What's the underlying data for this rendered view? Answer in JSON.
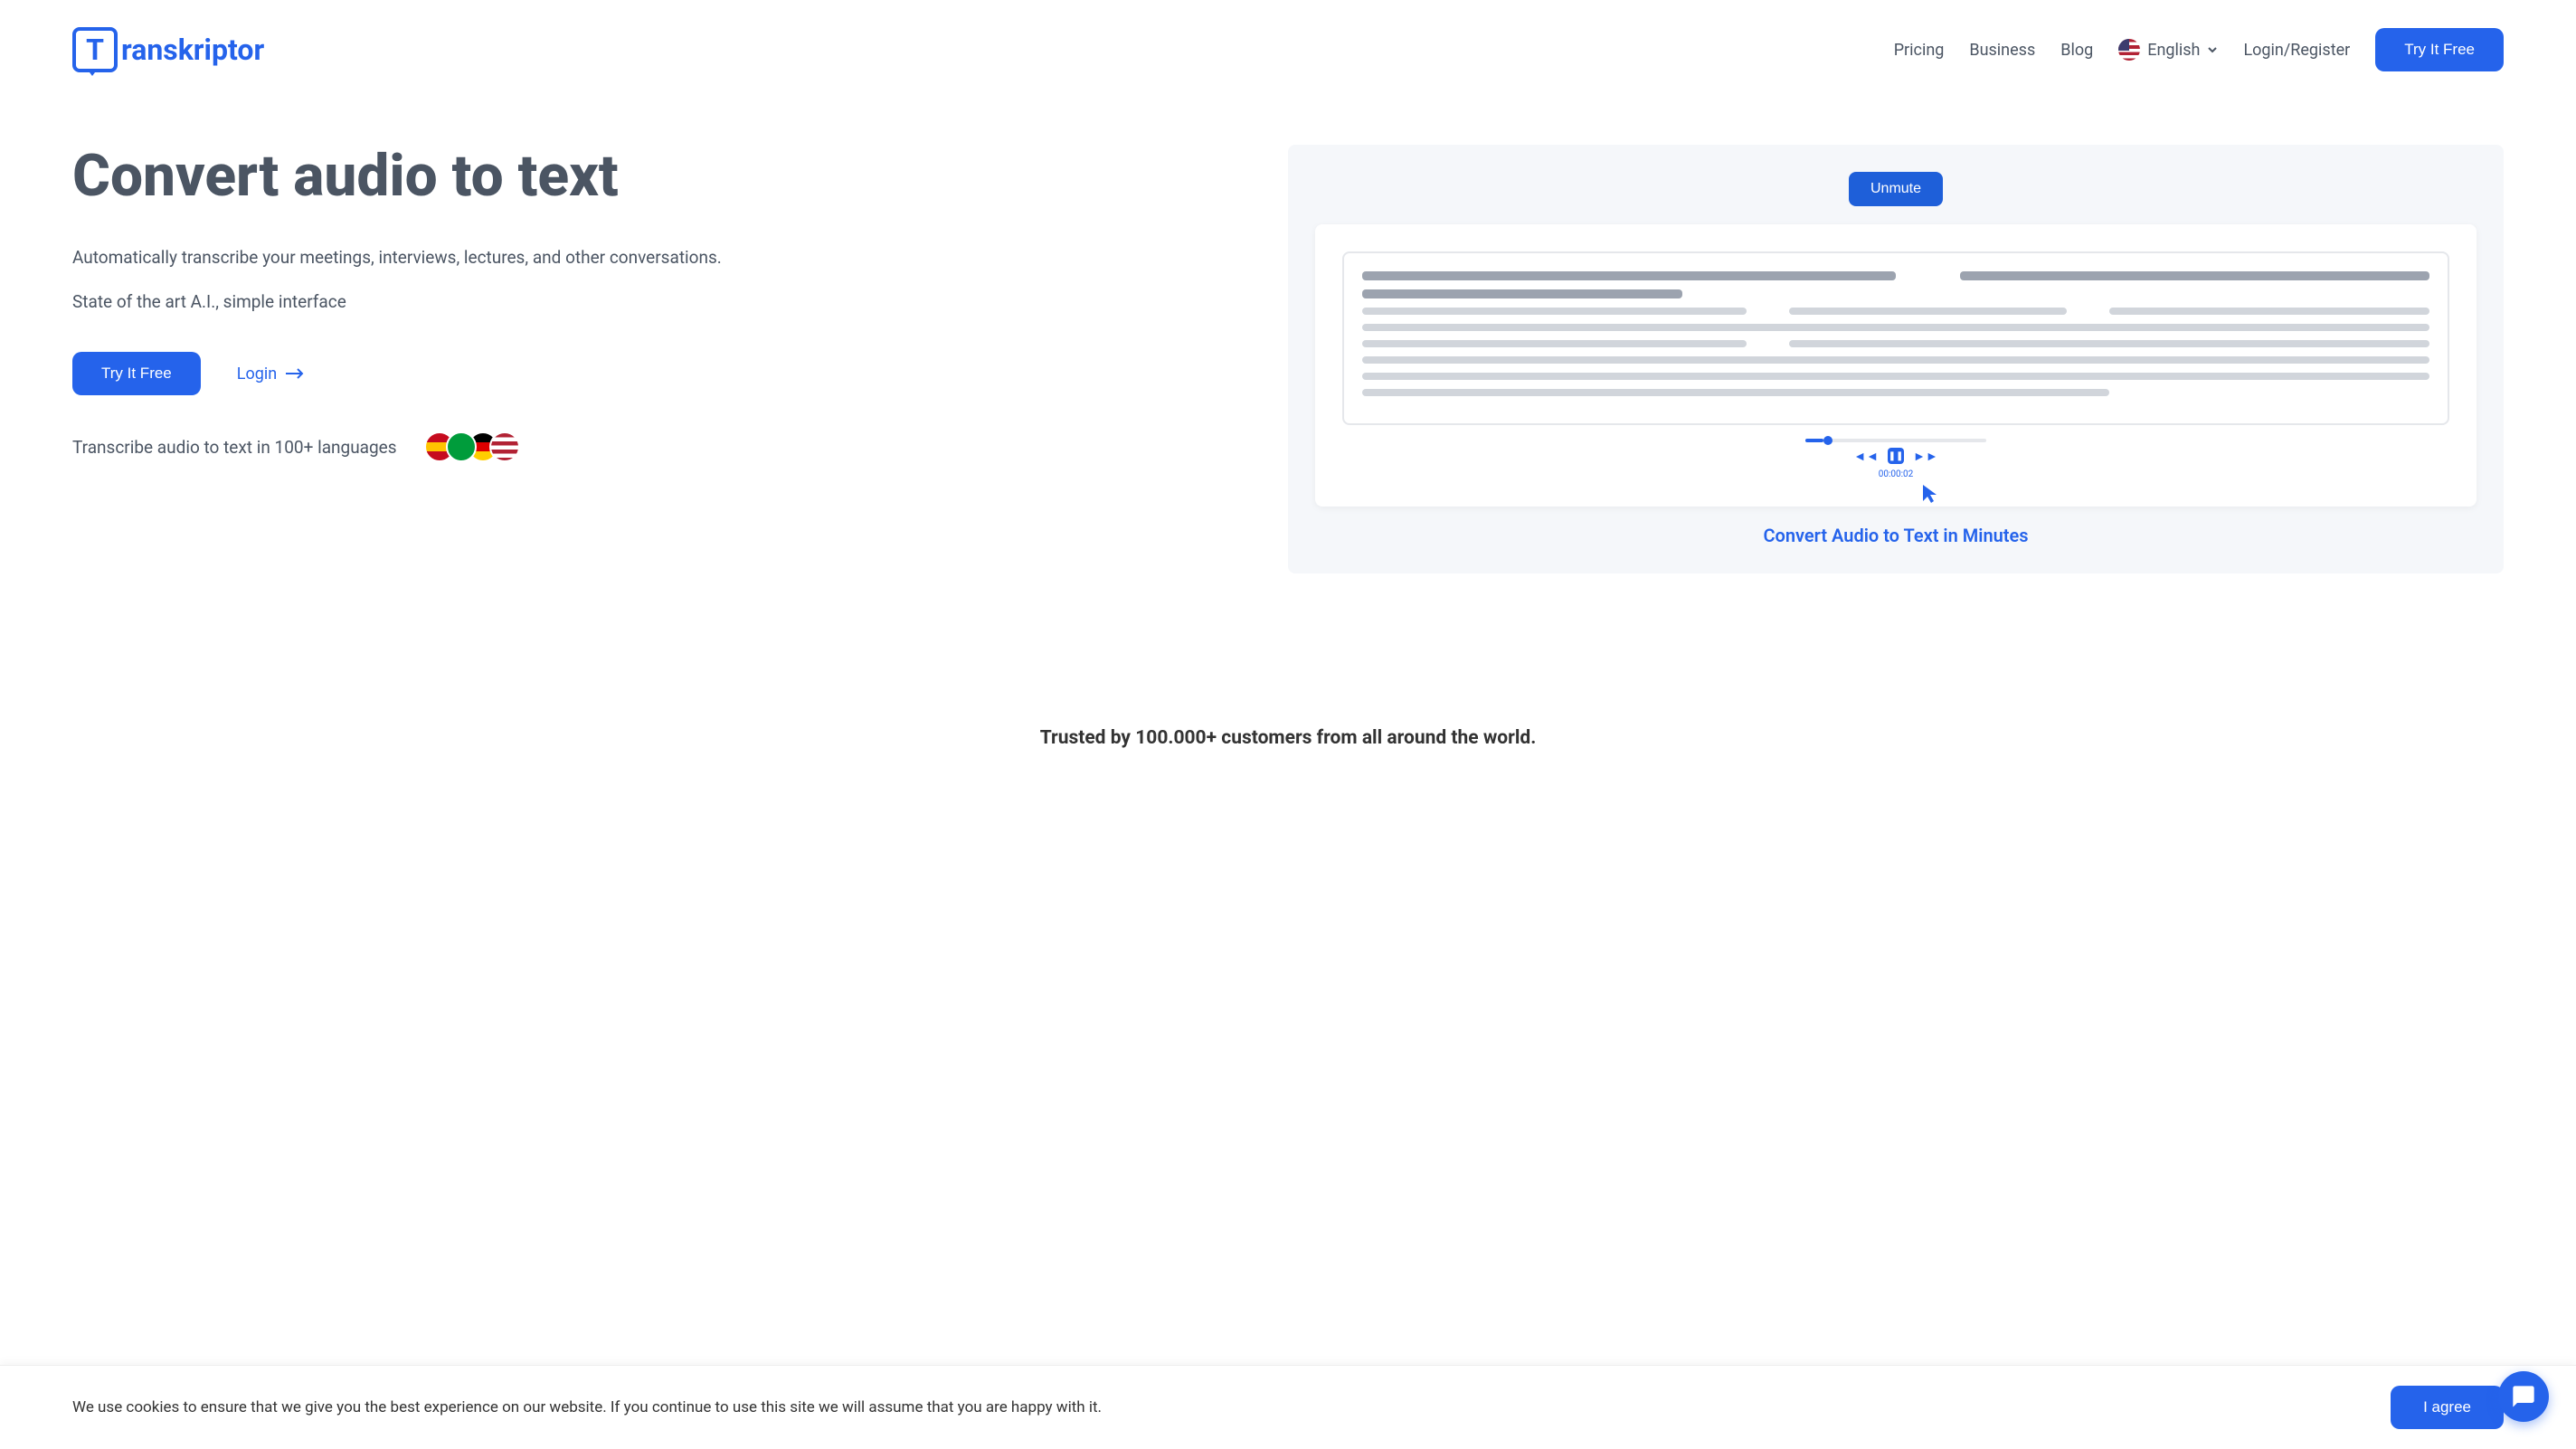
{
  "brand": "ranskriptor",
  "brand_letter": "T",
  "nav": {
    "pricing": "Pricing",
    "business": "Business",
    "blog": "Blog",
    "language": "English",
    "login": "Login/Register",
    "cta": "Try It Free"
  },
  "hero": {
    "title": "Convert audio to text",
    "desc1": "Automatically transcribe your meetings, interviews, lectures, and other conversations.",
    "desc2": "State of the art A.I., simple interface",
    "cta": "Try It Free",
    "login": "Login",
    "languages_text": "Transcribe audio to text in 100+ languages"
  },
  "video": {
    "unmute": "Unmute",
    "timestamp": "00:00:02",
    "caption": "Convert Audio to Text in Minutes"
  },
  "trusted": "Trusted by 100.000+ customers from all around the world.",
  "cookie": {
    "text": "We use cookies to ensure that we give you the best experience on our website. If you continue to use this site we will assume that you are happy with it.",
    "agree": "I agree"
  }
}
